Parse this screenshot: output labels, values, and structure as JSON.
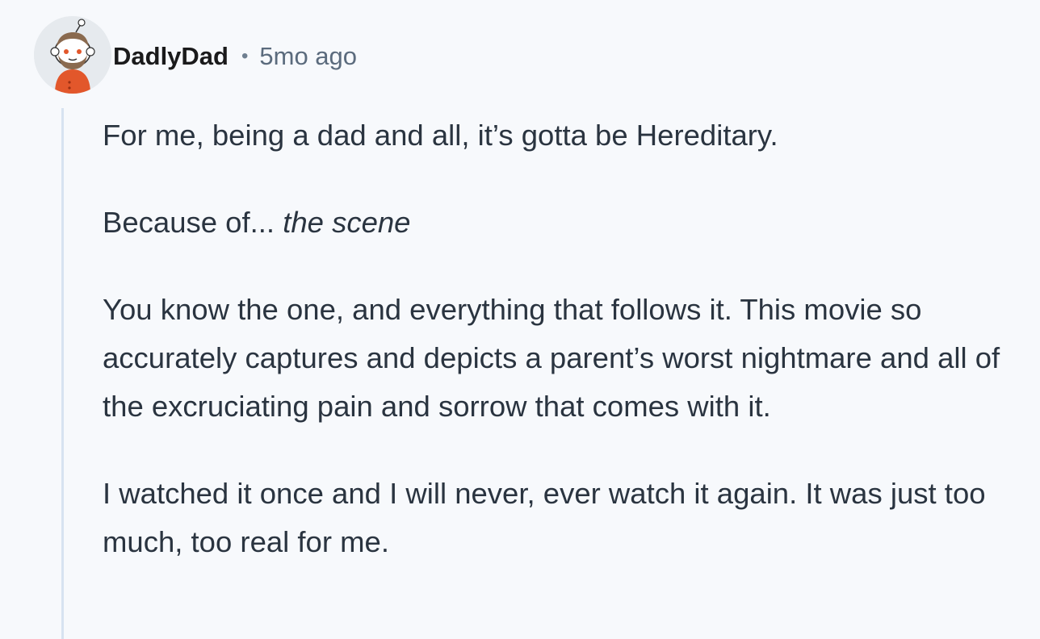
{
  "comment": {
    "author": "DadlyDad",
    "separator": "•",
    "timestamp": "5mo ago",
    "avatar": {
      "icon": "snoo-avatar-bearded-orange-shirt"
    },
    "paragraphs": {
      "p1": "For me, being a dad and all, it’s gotta be Hereditary.",
      "p2_plain": "Because of... ",
      "p2_italic": "the scene",
      "p3": "You know the one, and everything that follows it. This movie so accurately captures and depicts a parent’s worst nightmare and all of the excruciating pain and sorrow that comes with it.",
      "p4": "I watched it once and I will never, ever watch it again. It was just too much, too real for me."
    }
  },
  "colors": {
    "background": "#f7f9fc",
    "text": "#2a3440",
    "meta": "#5b6b7d",
    "thread_line": "#d7e3f1",
    "avatar_shirt": "#e2572b"
  }
}
